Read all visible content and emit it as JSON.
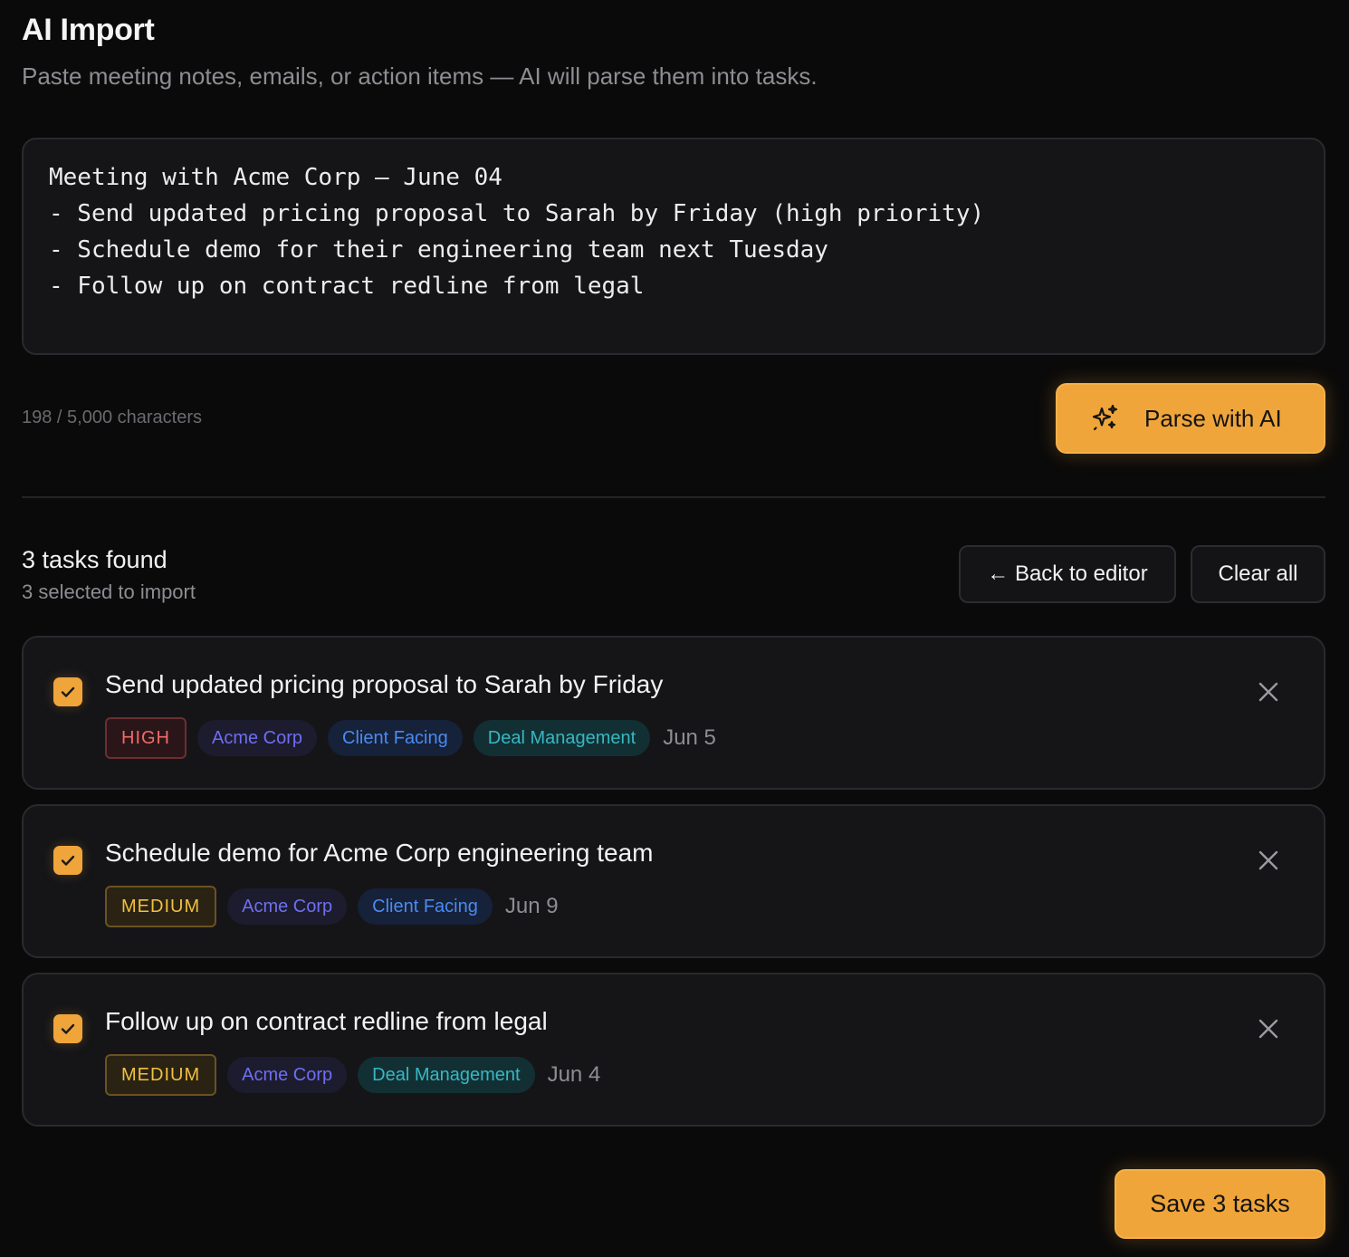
{
  "header": {
    "title": "AI Import",
    "subtitle": "Paste meeting notes, emails, or action items — AI will parse them into tasks."
  },
  "editor": {
    "lines": [
      "Meeting with Acme Corp – June 04",
      "- Send updated pricing proposal to Sarah by Friday (high priority)",
      "- Schedule demo for their engineering team next Tuesday",
      "- Follow up on contract redline from legal"
    ],
    "char_count": "198 / 5,000 characters"
  },
  "parse_button": {
    "label": "Parse with AI",
    "icon": "sparkles-icon"
  },
  "results": {
    "title": "3 tasks found",
    "subtitle": "3 selected to import",
    "back_label": "← Back to editor",
    "clear_label": "Clear all"
  },
  "tasks": [
    {
      "title": "Send updated pricing proposal to Sarah by Friday",
      "priority": "HIGH",
      "tags": [
        "Acme Corp",
        "Client Facing",
        "Deal Management"
      ],
      "date": "Jun 5",
      "checked": true
    },
    {
      "title": "Schedule demo for Acme Corp engineering team",
      "priority": "MEDIUM",
      "tags": [
        "Acme Corp",
        "Client Facing"
      ],
      "date": "Jun 9",
      "checked": true
    },
    {
      "title": "Follow up on contract redline from legal",
      "priority": "MEDIUM",
      "tags": [
        "Acme Corp",
        "Deal Management"
      ],
      "date": "Jun 4",
      "checked": true
    }
  ],
  "save_button": {
    "label": "Save 3 tasks"
  },
  "colors": {
    "accent": "#f0a53a",
    "background": "#0a0a0a",
    "card": "#151518",
    "priority_high": "#f06a6a",
    "priority_medium": "#f1c040",
    "tag_acme": "#6e6ef2",
    "tag_client": "#4a8bf0",
    "tag_deal": "#38b7c2"
  }
}
